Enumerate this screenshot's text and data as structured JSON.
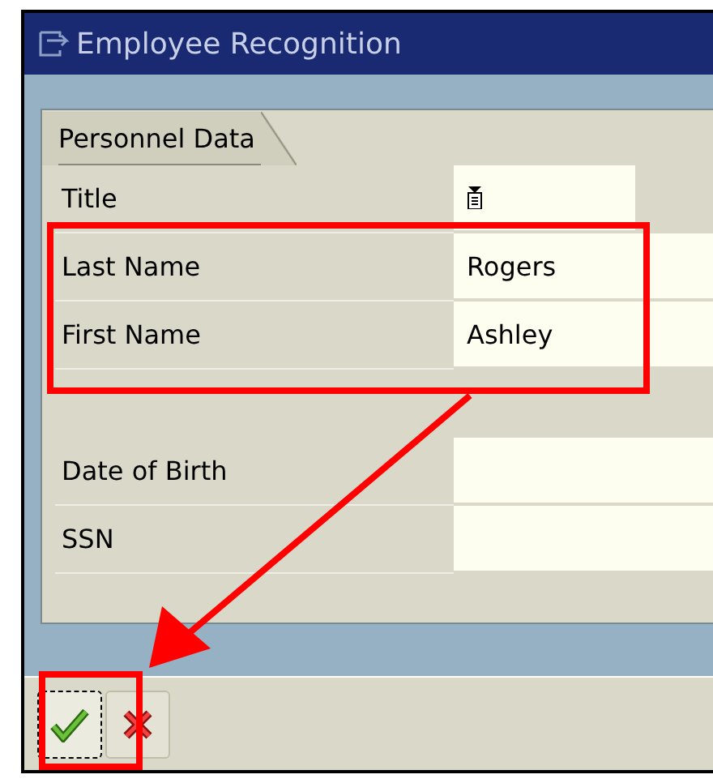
{
  "window": {
    "title": "Employee Recognition"
  },
  "tab": {
    "label": "Personnel Data"
  },
  "fields": [
    {
      "label": "Title",
      "kind": "dropdown"
    },
    {
      "label": "Last Name",
      "kind": "text",
      "value": "Rogers"
    },
    {
      "label": "First Name",
      "kind": "text",
      "value": "Ashley"
    },
    {
      "kind": "spacer"
    },
    {
      "label": "Date of Birth",
      "kind": "text"
    },
    {
      "label": "SSN",
      "kind": "text"
    }
  ],
  "buttons": [
    {
      "kind": "confirm",
      "focused": true
    },
    {
      "kind": "cancel",
      "focused": false
    }
  ]
}
